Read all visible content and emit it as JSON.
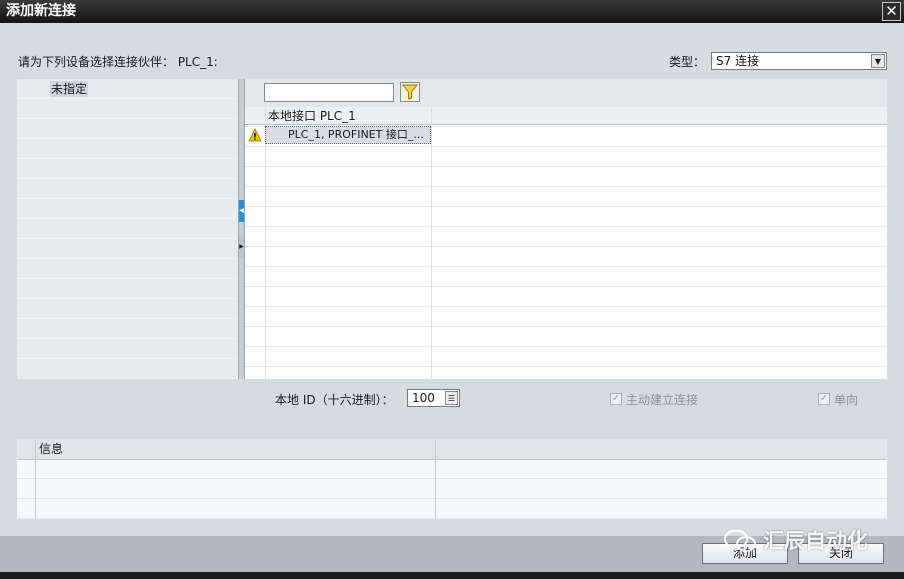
{
  "window": {
    "title": "添加新连接",
    "close_glyph": "✕"
  },
  "prompt": "请为下列设备选择连接伙伴： PLC_1:",
  "type_field": {
    "label": "类型：",
    "value": "S7 连接"
  },
  "left_tree": {
    "items": [
      {
        "label": "未指定"
      }
    ]
  },
  "filter": {
    "value": "",
    "icon": "filter-funnel-icon"
  },
  "grid": {
    "header": "本地接口 PLC_1",
    "rows": [
      {
        "status_icon": "warning-icon",
        "value": "PLC_1, PROFINET 接口_..."
      }
    ]
  },
  "local_id": {
    "label": "本地 ID（十六进制）：",
    "value": "100"
  },
  "options": {
    "active_connection": {
      "label": "主动建立连接",
      "checked": true,
      "enabled": false
    },
    "unidirectional": {
      "label": "单向",
      "checked": true,
      "enabled": false
    }
  },
  "info_panel": {
    "header": "信息"
  },
  "buttons": {
    "add": "添加",
    "close": "关闭"
  },
  "watermark": "汇辰自动化",
  "colors": {
    "warning": "#f5c400",
    "accent_handle": "#2a8fd6"
  }
}
